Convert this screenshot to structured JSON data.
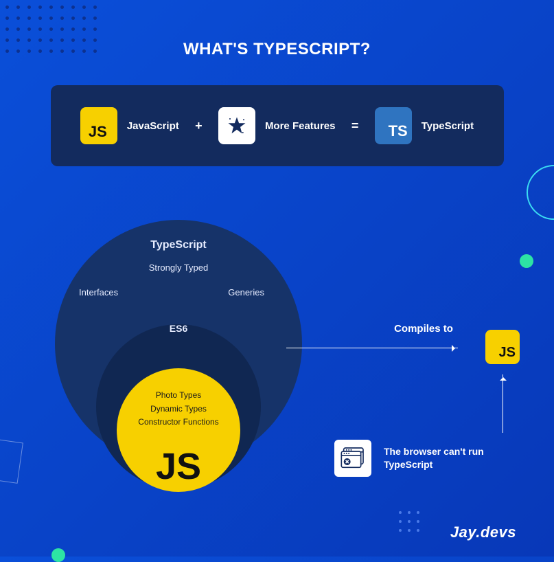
{
  "title": "WHAT'S TYPESCRIPT?",
  "equation": {
    "js_label": "JavaScript",
    "js_icon_text": "JS",
    "plus": "+",
    "features_label": "More Features",
    "equals": "=",
    "ts_label": "TypeScript",
    "ts_icon_text": "TS"
  },
  "venn": {
    "outer_title": "TypeScript",
    "strongly_typed": "Strongly Typed",
    "interfaces": "Interfaces",
    "generics": "Generies",
    "es6": "ES6",
    "inner_line1": "Photo Types",
    "inner_line2": "Dynamic Types",
    "inner_line3": "Constructor Functions",
    "inner_js": "JS"
  },
  "flow": {
    "compiles_to": "Compiles to",
    "js_target_text": "JS",
    "browser_note": "The browser can't run TypeScript"
  },
  "logo_text": "Jay.devs"
}
